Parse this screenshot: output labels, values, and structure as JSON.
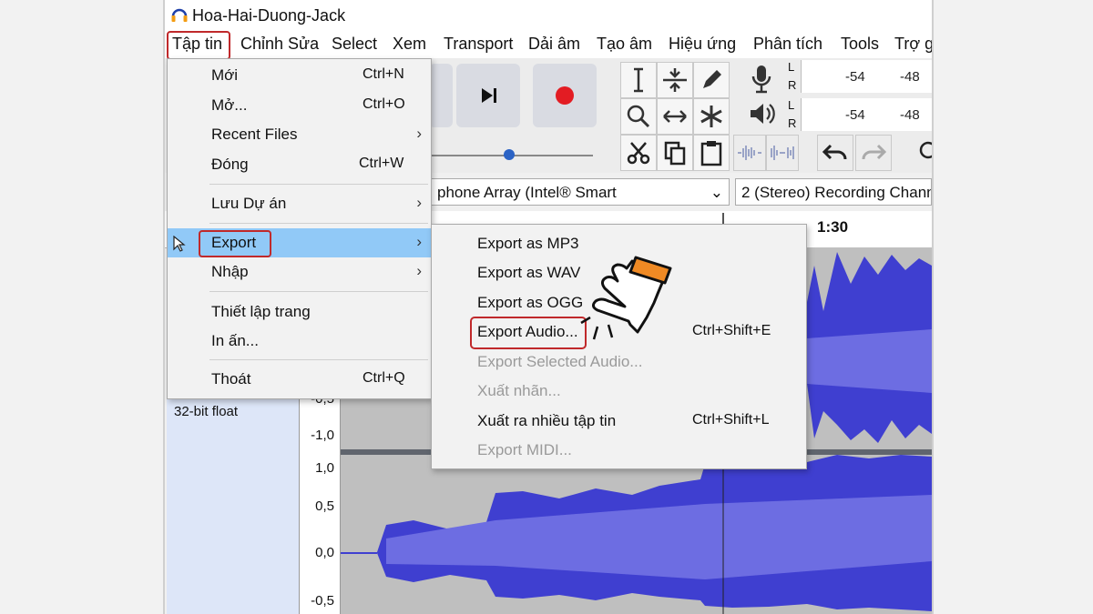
{
  "window": {
    "title": "Hoa-Hai-Duong-Jack"
  },
  "menubar": [
    {
      "label": "Tập tin"
    },
    {
      "label": "Chỉnh Sửa"
    },
    {
      "label": "Select"
    },
    {
      "label": "Xem"
    },
    {
      "label": "Transport"
    },
    {
      "label": "Dải âm"
    },
    {
      "label": "Tạo âm"
    },
    {
      "label": "Hiệu ứng"
    },
    {
      "label": "Phân tích"
    },
    {
      "label": "Tools"
    },
    {
      "label": "Trợ g"
    }
  ],
  "meters": {
    "record": {
      "l": "L",
      "r": "R",
      "tick1": "-54",
      "tick2": "-48"
    },
    "play": {
      "l": "L",
      "r": "R",
      "tick1": "-54",
      "tick2": "-48"
    }
  },
  "devices": {
    "input": "phone Array (Intel® Smart",
    "channels": "2 (Stereo) Recording Chann"
  },
  "timeline": {
    "mark": "1:30"
  },
  "track": {
    "info": "32-bit float"
  },
  "scale_top": [
    "-0,5",
    "-1,0"
  ],
  "scale_bottom": [
    "1,0",
    "0,5",
    "0,0",
    "-0,5"
  ],
  "file_menu": [
    {
      "label": "Mới",
      "shortcut": "Ctrl+N"
    },
    {
      "label": "Mở...",
      "shortcut": "Ctrl+O"
    },
    {
      "label": "Recent Files",
      "arrow": "›"
    },
    {
      "label": "Đóng",
      "shortcut": "Ctrl+W"
    },
    {
      "label": "Lưu Dự án",
      "arrow": "›"
    },
    {
      "label": "Export",
      "arrow": "›"
    },
    {
      "label": "Nhập",
      "arrow": "›"
    },
    {
      "label": "Thiết lập trang"
    },
    {
      "label": "In ấn..."
    },
    {
      "label": "Thoát",
      "shortcut": "Ctrl+Q"
    }
  ],
  "export_menu": [
    {
      "label": "Export as MP3"
    },
    {
      "label": "Export as WAV"
    },
    {
      "label": "Export as OGG"
    },
    {
      "label": "Export Audio...",
      "shortcut": "Ctrl+Shift+E"
    },
    {
      "label": "Export Selected Audio..."
    },
    {
      "label": "Xuất nhãn..."
    },
    {
      "label": "Xuất ra nhiều tập tin",
      "shortcut": "Ctrl+Shift+L"
    },
    {
      "label": "Export MIDI..."
    }
  ],
  "colors": {
    "highlight_border": "#c0292b",
    "menu_selection": "#91c9f7",
    "waveform": "#3f3fd0",
    "record_red": "#e31c23",
    "hand_orange": "#f08a24"
  }
}
